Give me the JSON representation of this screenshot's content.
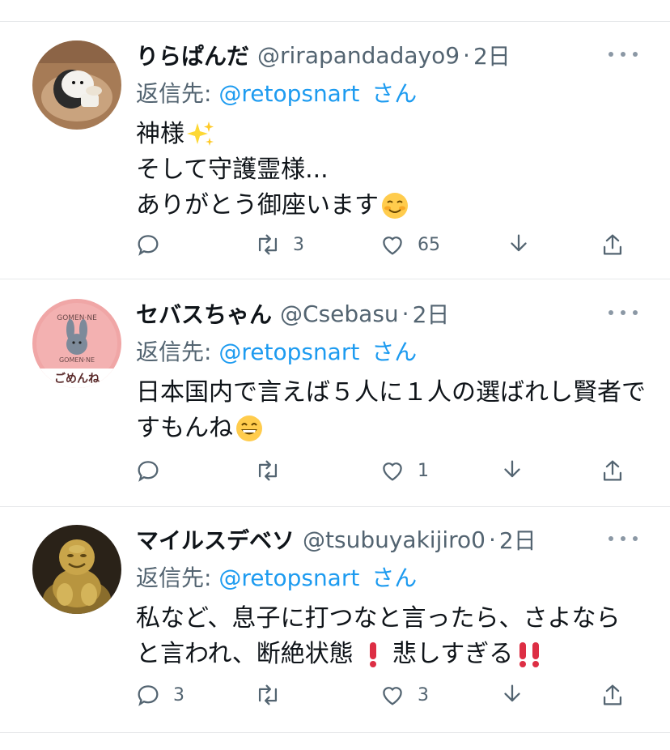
{
  "tweets": [
    {
      "name": "りらぱんだ",
      "handle": "@rirapandadayo9",
      "time": "2日",
      "reply_label": "返信先:",
      "reply_to": "@retopsnart",
      "reply_suffix": "さん",
      "lines": [
        "神様",
        "そして守護霊様...",
        "ありがとう御座います"
      ],
      "emoji_line1": "sparkles",
      "emoji_line3": "smiling-face-blush",
      "replies": "",
      "retweets": "3",
      "likes": "65",
      "avatar": "bird-rice-ball-avatar"
    },
    {
      "name": "セバスちゃん",
      "handle": "@Csebasu",
      "time": "2日",
      "reply_label": "返信先:",
      "reply_to": "@retopsnart",
      "reply_suffix": "さん",
      "lines": [
        "日本国内で言えば５人に１人の選ばれし賢者で",
        "すもんね"
      ],
      "emoji_line2": "grinning-face",
      "replies": "",
      "retweets": "",
      "likes": "1",
      "avatar_text_top": "GOMEN·NE",
      "avatar_text_mid": "GOMEN·NE",
      "avatar_text_bottom": "ごめんね"
    },
    {
      "name": "マイルスデベソ",
      "handle": "@tsubuyakijiro0",
      "time": "2日",
      "reply_label": "返信先:",
      "reply_to": "@retopsnart",
      "reply_suffix": "さん",
      "lines": [
        "私など、息子に打つなと言ったら、さよなら",
        "と言われ、断絶状態",
        "悲しすぎる"
      ],
      "emoji_line2": "red-exclamation",
      "emoji_line2b": "double-red-exclamation",
      "replies": "3",
      "retweets": "",
      "likes": "3",
      "avatar": "golden-buddha-avatar"
    }
  ],
  "colors": {
    "text": "#0f1419",
    "secondary": "#536471",
    "link": "#1d9bf0",
    "divider": "#e6e8ea"
  }
}
